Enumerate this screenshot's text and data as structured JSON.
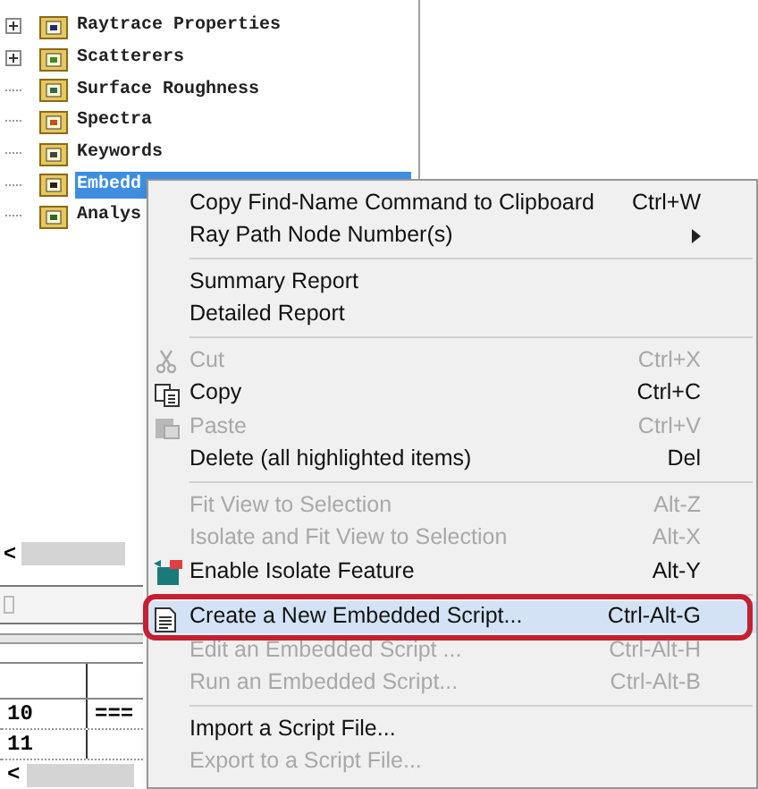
{
  "tree": {
    "items": [
      {
        "label": "Raytrace Properties",
        "expandable": true,
        "selected": false
      },
      {
        "label": "Scatterers",
        "expandable": true,
        "selected": false
      },
      {
        "label": "Surface Roughness",
        "expandable": false,
        "selected": false
      },
      {
        "label": "Spectra",
        "expandable": false,
        "selected": false
      },
      {
        "label": "Keywords",
        "expandable": false,
        "selected": false
      },
      {
        "label": "Embedd",
        "expandable": false,
        "selected": true
      },
      {
        "label": "Analys",
        "expandable": false,
        "selected": false
      }
    ]
  },
  "scroll_button": "<",
  "table": {
    "rows": [
      [
        "10",
        "==="
      ],
      [
        "11",
        ""
      ]
    ],
    "scroll_button": "<"
  },
  "context_menu": {
    "items": [
      {
        "kind": "item",
        "label": "Copy Find-Name Command to Clipboard",
        "shortcut": "Ctrl+W",
        "disabled": false,
        "submenu": false,
        "selected": false,
        "outlined": false
      },
      {
        "kind": "item",
        "label": "Ray Path Node Number(s)",
        "disabled": false,
        "submenu": true,
        "selected": false,
        "outlined": false
      },
      {
        "kind": "separator"
      },
      {
        "kind": "item",
        "label": "Summary Report",
        "disabled": false,
        "submenu": false,
        "selected": false,
        "outlined": false
      },
      {
        "kind": "item",
        "label": "Detailed Report",
        "disabled": false,
        "submenu": false,
        "selected": false,
        "outlined": false
      },
      {
        "kind": "separator"
      },
      {
        "kind": "item",
        "label": "Cut",
        "shortcut": "Ctrl+X",
        "disabled": true,
        "submenu": false,
        "selected": false,
        "outlined": false
      },
      {
        "kind": "item",
        "label": "Copy",
        "shortcut": "Ctrl+C",
        "disabled": false,
        "submenu": false,
        "selected": false,
        "outlined": false
      },
      {
        "kind": "item",
        "label": "Paste",
        "shortcut": "Ctrl+V",
        "disabled": true,
        "submenu": false,
        "selected": false,
        "outlined": false
      },
      {
        "kind": "item",
        "label": "Delete (all highlighted items)",
        "shortcut": "Del",
        "disabled": false,
        "submenu": false,
        "selected": false,
        "outlined": false
      },
      {
        "kind": "separator"
      },
      {
        "kind": "item",
        "label": "Fit View to Selection",
        "shortcut": "Alt-Z",
        "disabled": true,
        "submenu": false,
        "selected": false,
        "outlined": false
      },
      {
        "kind": "item",
        "label": "Isolate and Fit View to Selection",
        "shortcut": "Alt-X",
        "disabled": true,
        "submenu": false,
        "selected": false,
        "outlined": false
      },
      {
        "kind": "item",
        "label": "Enable Isolate Feature",
        "shortcut": "Alt-Y",
        "disabled": false,
        "submenu": false,
        "selected": false,
        "outlined": false
      },
      {
        "kind": "separator"
      },
      {
        "kind": "item",
        "label": "Create a New Embedded Script...",
        "shortcut": "Ctrl-Alt-G",
        "disabled": false,
        "submenu": false,
        "selected": true,
        "outlined": true
      },
      {
        "kind": "item",
        "label": "Edit an Embedded Script ...",
        "shortcut": "Ctrl-Alt-H",
        "disabled": true,
        "submenu": false,
        "selected": false,
        "outlined": false
      },
      {
        "kind": "item",
        "label": "Run an Embedded Script...",
        "shortcut": "Ctrl-Alt-B",
        "disabled": true,
        "submenu": false,
        "selected": false,
        "outlined": false
      },
      {
        "kind": "separator"
      },
      {
        "kind": "item",
        "label": "Import a Script File...",
        "disabled": false,
        "submenu": false,
        "selected": false,
        "outlined": false
      },
      {
        "kind": "item",
        "label": "Export to a Script File...",
        "disabled": true,
        "submenu": false,
        "selected": false,
        "outlined": false
      }
    ]
  }
}
